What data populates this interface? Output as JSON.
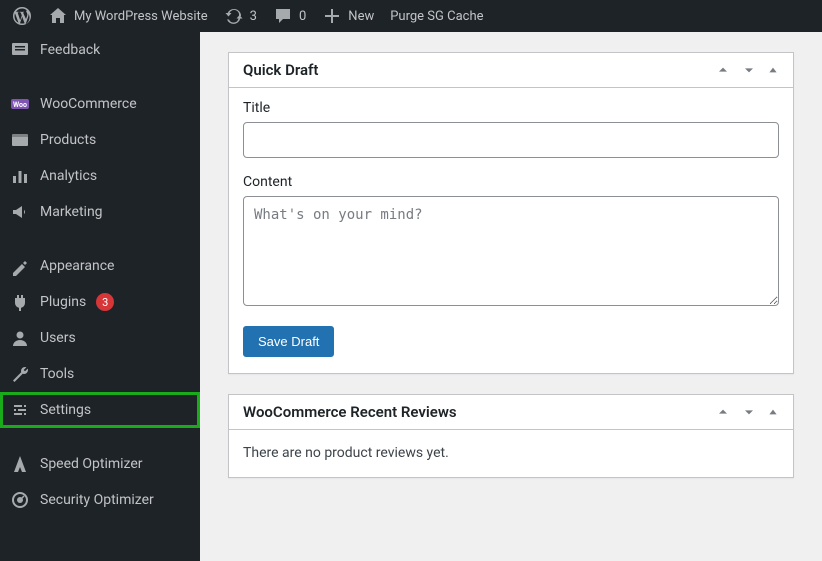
{
  "adminbar": {
    "site_name": "My WordPress Website",
    "updates_count": "3",
    "comments_count": "0",
    "new_label": "New",
    "purge_label": "Purge SG Cache"
  },
  "sidebar": {
    "feedback": "Feedback",
    "woocommerce": "WooCommerce",
    "products": "Products",
    "analytics": "Analytics",
    "marketing": "Marketing",
    "appearance": "Appearance",
    "plugins": "Plugins",
    "plugins_badge": "3",
    "users": "Users",
    "tools": "Tools",
    "settings": "Settings",
    "speed_optimizer": "Speed Optimizer",
    "security_optimizer": "Security Optimizer"
  },
  "quickdraft": {
    "title": "Quick Draft",
    "title_label": "Title",
    "content_label": "Content",
    "content_placeholder": "What's on your mind?",
    "save_label": "Save Draft"
  },
  "reviews": {
    "title": "WooCommerce Recent Reviews",
    "empty": "There are no product reviews yet."
  }
}
